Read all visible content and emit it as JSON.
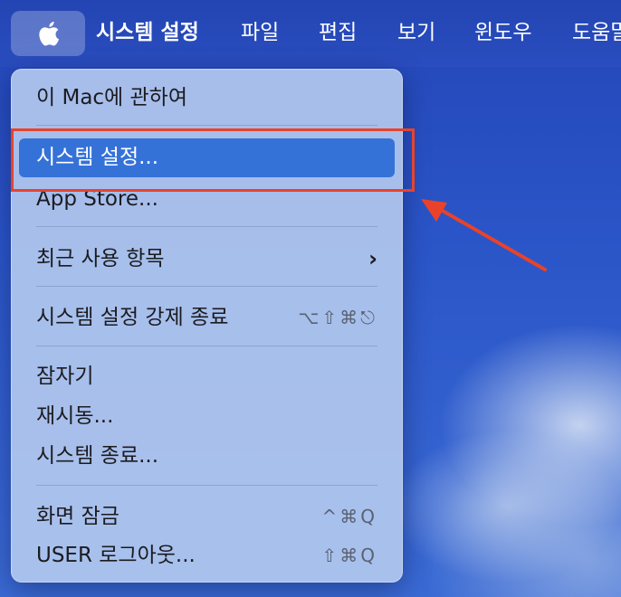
{
  "menubar": {
    "apple_icon": "apple-logo-icon",
    "app_name": "시스템 설정",
    "items": [
      "파일",
      "편집",
      "보기",
      "윈도우",
      "도움말"
    ]
  },
  "apple_menu": {
    "items": [
      {
        "label": "이 Mac에 관하여",
        "shortcut": ""
      },
      {
        "label": "시스템 설정...",
        "shortcut": "",
        "highlighted": true
      },
      {
        "label": "App Store...",
        "shortcut": ""
      },
      {
        "label": "최근 사용 항목",
        "shortcut": "",
        "submenu_icon": "chevron-right-icon"
      },
      {
        "label": "시스템 설정 강제 종료",
        "shortcut": "⌥⇧⌘⎋"
      },
      {
        "label": "잠자기",
        "shortcut": ""
      },
      {
        "label": "재시동...",
        "shortcut": ""
      },
      {
        "label": "시스템 종료...",
        "shortcut": ""
      },
      {
        "label": "화면 잠금",
        "shortcut": "^⌘Q"
      },
      {
        "label": "USER 로그아웃...",
        "shortcut": "⇧⌘Q"
      }
    ]
  },
  "annotations": {
    "highlight_color": "#e8432a",
    "arrow_icon": "red-arrow-icon"
  },
  "colors": {
    "menu_highlight": "#3572d8",
    "menubar": "#2a4dbf"
  }
}
